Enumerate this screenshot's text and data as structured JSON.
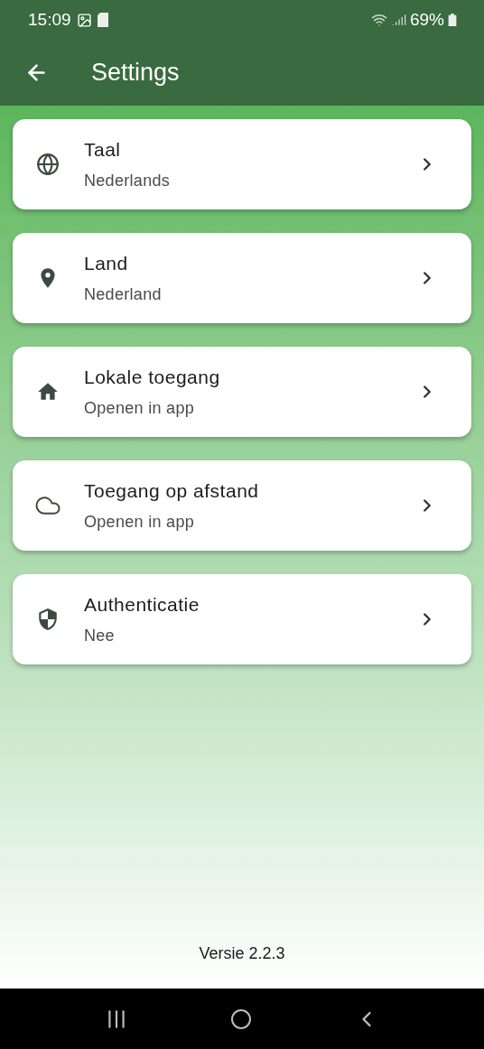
{
  "status_bar": {
    "time": "15:09",
    "battery": "69%"
  },
  "app_bar": {
    "title": "Settings"
  },
  "items": [
    {
      "kind": "globe",
      "title": "Taal",
      "value": "Nederlands"
    },
    {
      "kind": "pin",
      "title": "Land",
      "value": "Nederland"
    },
    {
      "kind": "home",
      "title": "Lokale toegang",
      "value": "Openen in app"
    },
    {
      "kind": "cloud",
      "title": "Toegang op afstand",
      "value": "Openen in app"
    },
    {
      "kind": "shield",
      "title": "Authenticatie",
      "value": "Nee"
    }
  ],
  "footer": {
    "version": "Versie 2.2.3"
  }
}
